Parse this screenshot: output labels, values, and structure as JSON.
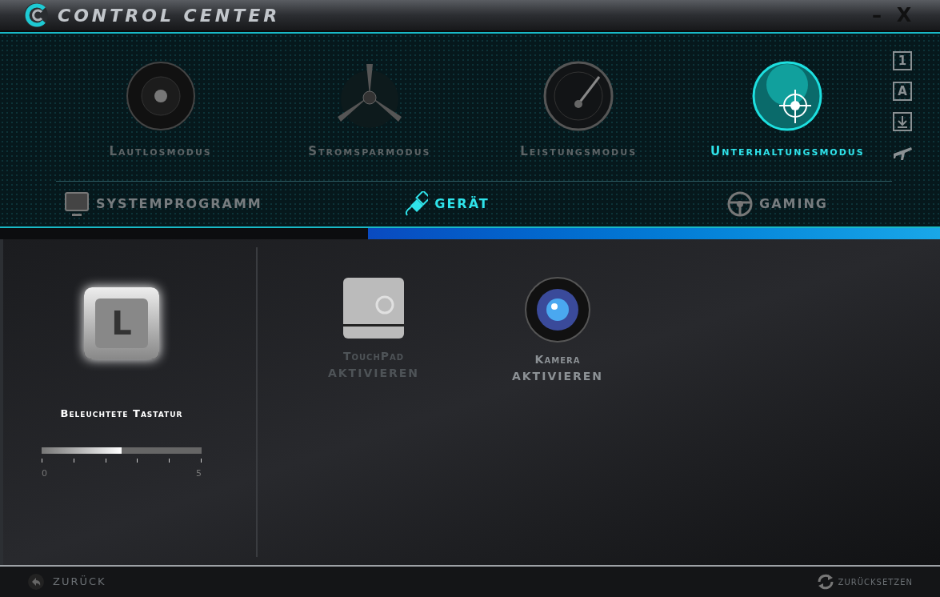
{
  "window": {
    "title": "CONTROL CENTER",
    "controls": [
      "–",
      "X"
    ]
  },
  "modes": [
    {
      "label": "Lautlosmodus",
      "kind": "silent",
      "selected": false
    },
    {
      "label": "Stromsparmodus",
      "kind": "fan",
      "selected": false
    },
    {
      "label": "Leistungsmodus",
      "kind": "gauge",
      "selected": false
    },
    {
      "label": "Unterhaltungsmodus",
      "kind": "target",
      "selected": true
    }
  ],
  "side_buttons": [
    {
      "kind": "text",
      "label": "1"
    },
    {
      "kind": "text",
      "label": "A"
    },
    {
      "kind": "download"
    },
    {
      "kind": "airplane"
    }
  ],
  "tabs": [
    {
      "label": "SYSTEMPROGRAMM",
      "kind": "monitor",
      "selected": false
    },
    {
      "label": "GERÄT",
      "kind": "plug",
      "selected": true
    },
    {
      "label": "GAMING",
      "kind": "wheel",
      "selected": false
    }
  ],
  "keyboard": {
    "label": "Beleuchtete Tastatur",
    "key": "L",
    "level": 0.5,
    "min": "0",
    "max": "5"
  },
  "devices": [
    {
      "kind": "touchpad",
      "name": "TouchPad",
      "action": "AKTIVIEREN",
      "enabled": false
    },
    {
      "kind": "camera",
      "name": "Kamera",
      "action": "AKTIVIEREN",
      "enabled": true
    }
  ],
  "footer": {
    "back": "ZURÜCK",
    "reset": "ZURÜCKSETZEN"
  }
}
